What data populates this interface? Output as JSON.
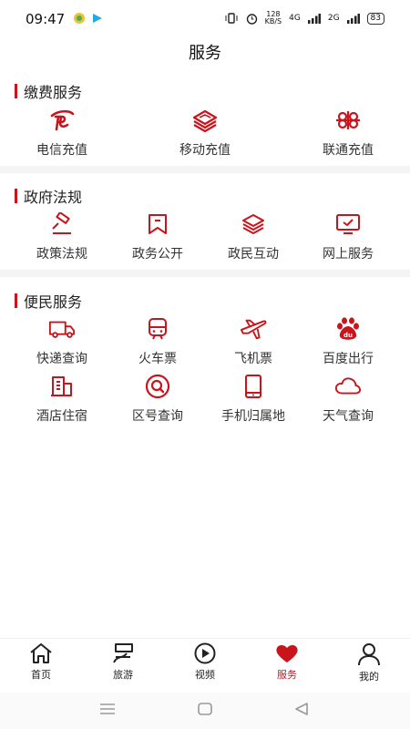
{
  "status": {
    "time": "09:47",
    "net_speed": "128\nKB/S",
    "signal1": "4G",
    "signal2": "2G",
    "battery": "83"
  },
  "page": {
    "title": "服务"
  },
  "sections": {
    "payment": {
      "title": "缴费服务",
      "items": [
        {
          "label": "电信充值",
          "icon": "telecom-icon"
        },
        {
          "label": "移动充值",
          "icon": "mobile-icon"
        },
        {
          "label": "联通充值",
          "icon": "unicom-icon"
        }
      ]
    },
    "gov": {
      "title": "政府法规",
      "items": [
        {
          "label": "政策法规",
          "icon": "gavel-icon"
        },
        {
          "label": "政务公开",
          "icon": "bookmark-icon"
        },
        {
          "label": "政民互动",
          "icon": "layers-icon"
        },
        {
          "label": "网上服务",
          "icon": "monitor-check-icon"
        }
      ]
    },
    "life": {
      "title": "便民服务",
      "items": [
        {
          "label": "快递查询",
          "icon": "truck-icon"
        },
        {
          "label": "火车票",
          "icon": "train-icon"
        },
        {
          "label": "飞机票",
          "icon": "plane-icon"
        },
        {
          "label": "百度出行",
          "icon": "baidu-icon"
        },
        {
          "label": "酒店住宿",
          "icon": "hotel-icon"
        },
        {
          "label": "区号查询",
          "icon": "search-circle-icon"
        },
        {
          "label": "手机归属地",
          "icon": "phone-icon"
        },
        {
          "label": "天气查询",
          "icon": "cloud-icon"
        }
      ]
    }
  },
  "nav": {
    "items": [
      {
        "label": "首页",
        "icon": "home-icon"
      },
      {
        "label": "旅游",
        "icon": "travel-icon"
      },
      {
        "label": "视频",
        "icon": "play-icon"
      },
      {
        "label": "服务",
        "icon": "heart-icon",
        "active": true
      },
      {
        "label": "我的",
        "icon": "user-icon"
      }
    ]
  },
  "colors": {
    "accent": "#c9141c"
  }
}
